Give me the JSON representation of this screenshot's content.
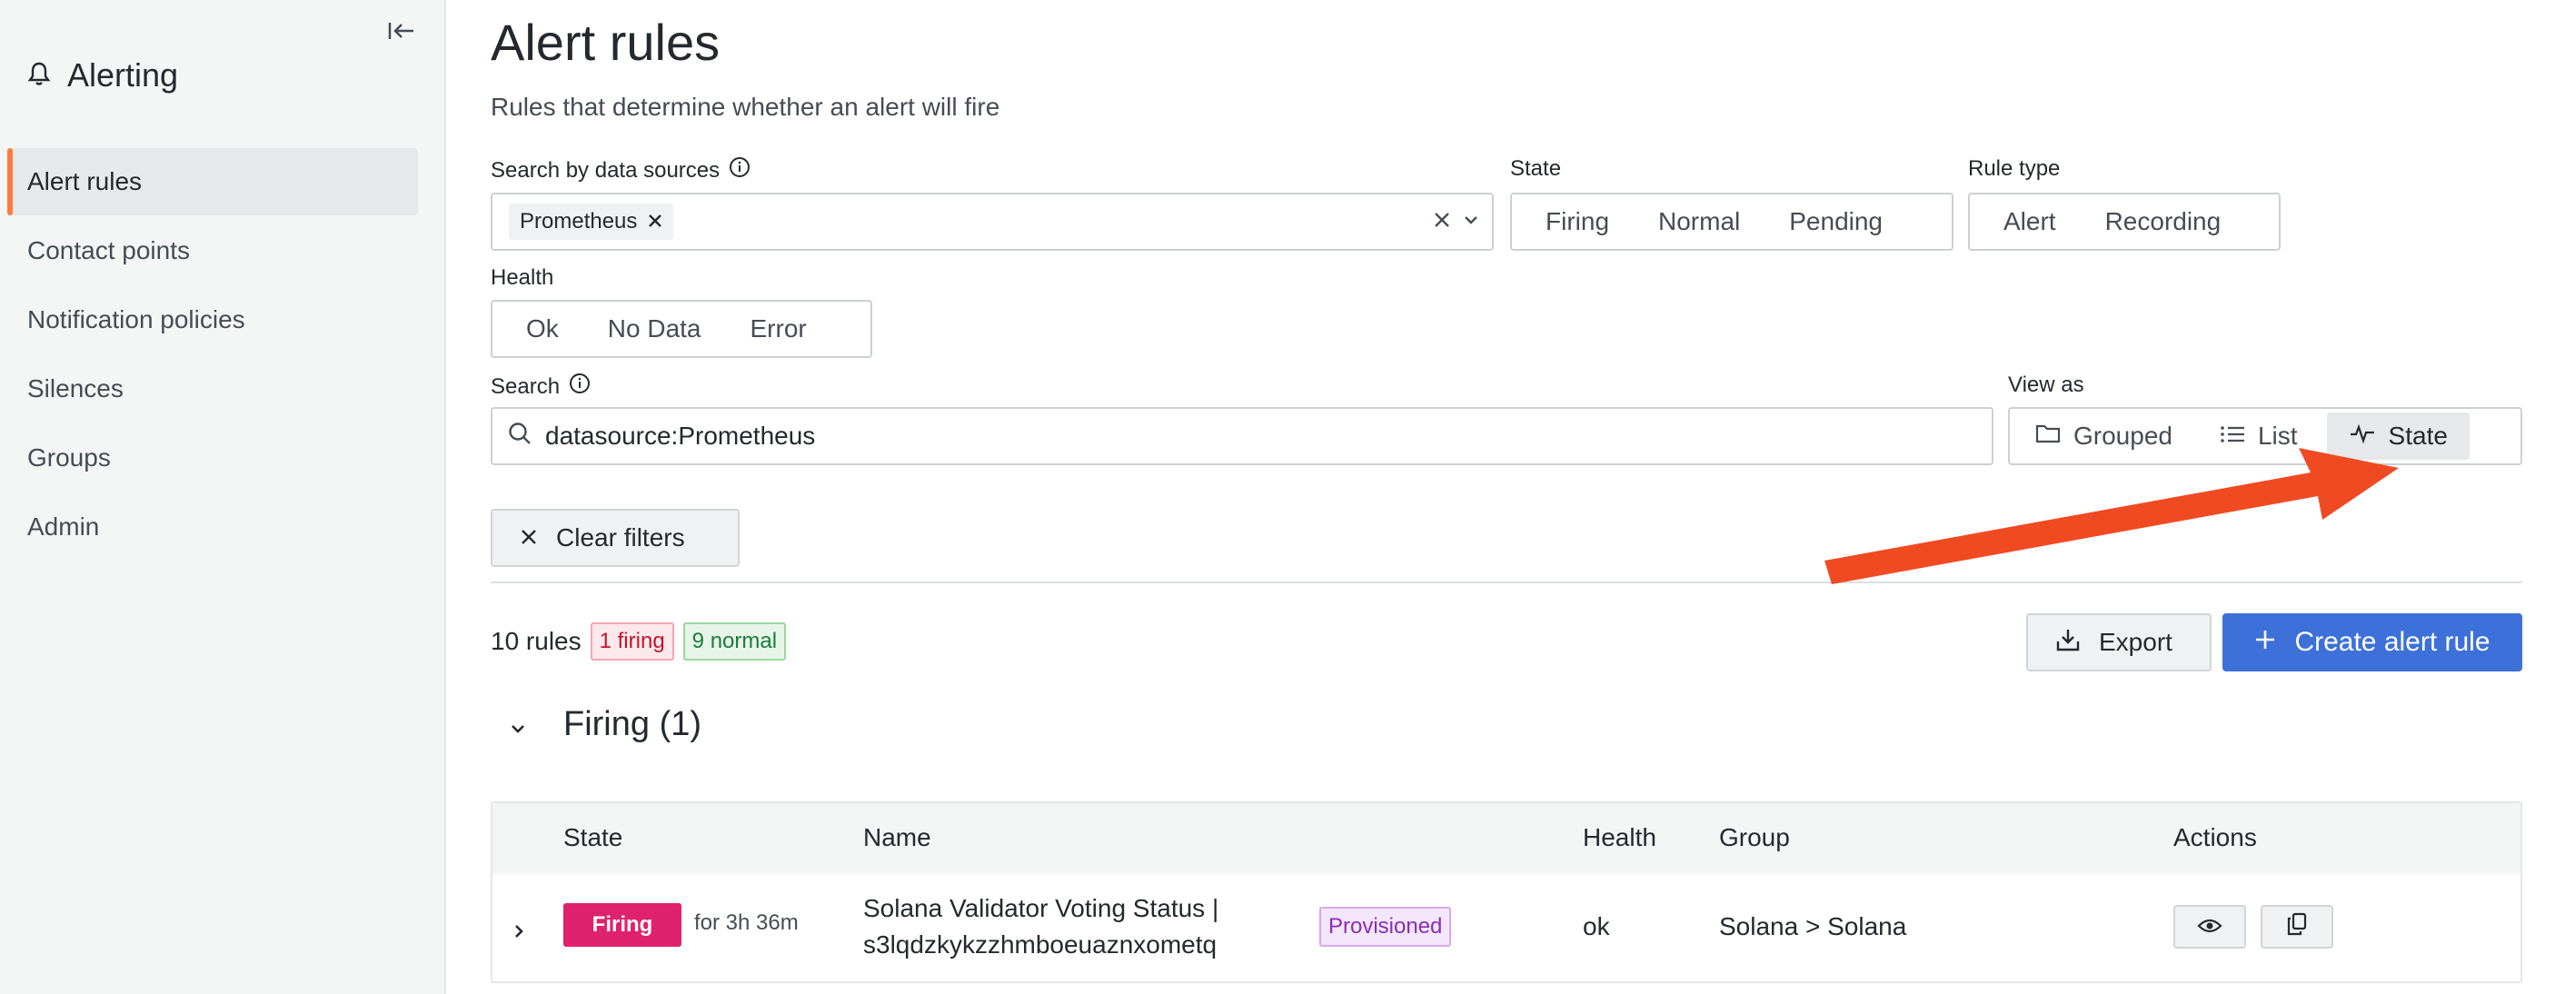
{
  "sidebar": {
    "title": "Alerting",
    "items": [
      {
        "label": "Alert rules",
        "active": true
      },
      {
        "label": "Contact points"
      },
      {
        "label": "Notification policies"
      },
      {
        "label": "Silences"
      },
      {
        "label": "Groups"
      },
      {
        "label": "Admin"
      }
    ]
  },
  "page": {
    "title": "Alert rules",
    "subtitle": "Rules that determine whether an alert will fire"
  },
  "filters": {
    "datasources_label": "Search by data sources",
    "datasource_chip": "Prometheus",
    "state_label": "State",
    "state_options": [
      "Firing",
      "Normal",
      "Pending"
    ],
    "ruletype_label": "Rule type",
    "ruletype_options": [
      "Alert",
      "Recording"
    ],
    "health_label": "Health",
    "health_options": [
      "Ok",
      "No Data",
      "Error"
    ],
    "search_label": "Search",
    "search_value": "datasource:Prometheus",
    "viewas_label": "View as",
    "view_options": [
      "Grouped",
      "List",
      "State"
    ],
    "view_selected": "State",
    "clear_label": "Clear filters"
  },
  "summary": {
    "count": "10 rules",
    "firing": "1 firing",
    "normal": "9 normal",
    "export_label": "Export",
    "create_label": "Create alert rule"
  },
  "section": {
    "title": "Firing (1)"
  },
  "table": {
    "headers": [
      "State",
      "Name",
      "Health",
      "Group",
      "Actions"
    ],
    "rows": [
      {
        "state": "Firing",
        "duration": "for 3h 36m",
        "name_line1": "Solana Validator Voting Status |",
        "name_line2": "s3lqdzkykzzhmboeuaznxometq",
        "tag": "Provisioned",
        "health": "ok",
        "group": "Solana > Solana"
      }
    ]
  },
  "colors": {
    "accent": "#3d71d9",
    "firing": "#e0226e",
    "arrow": "#f04a23",
    "active_nav": "#ff7a3d"
  }
}
